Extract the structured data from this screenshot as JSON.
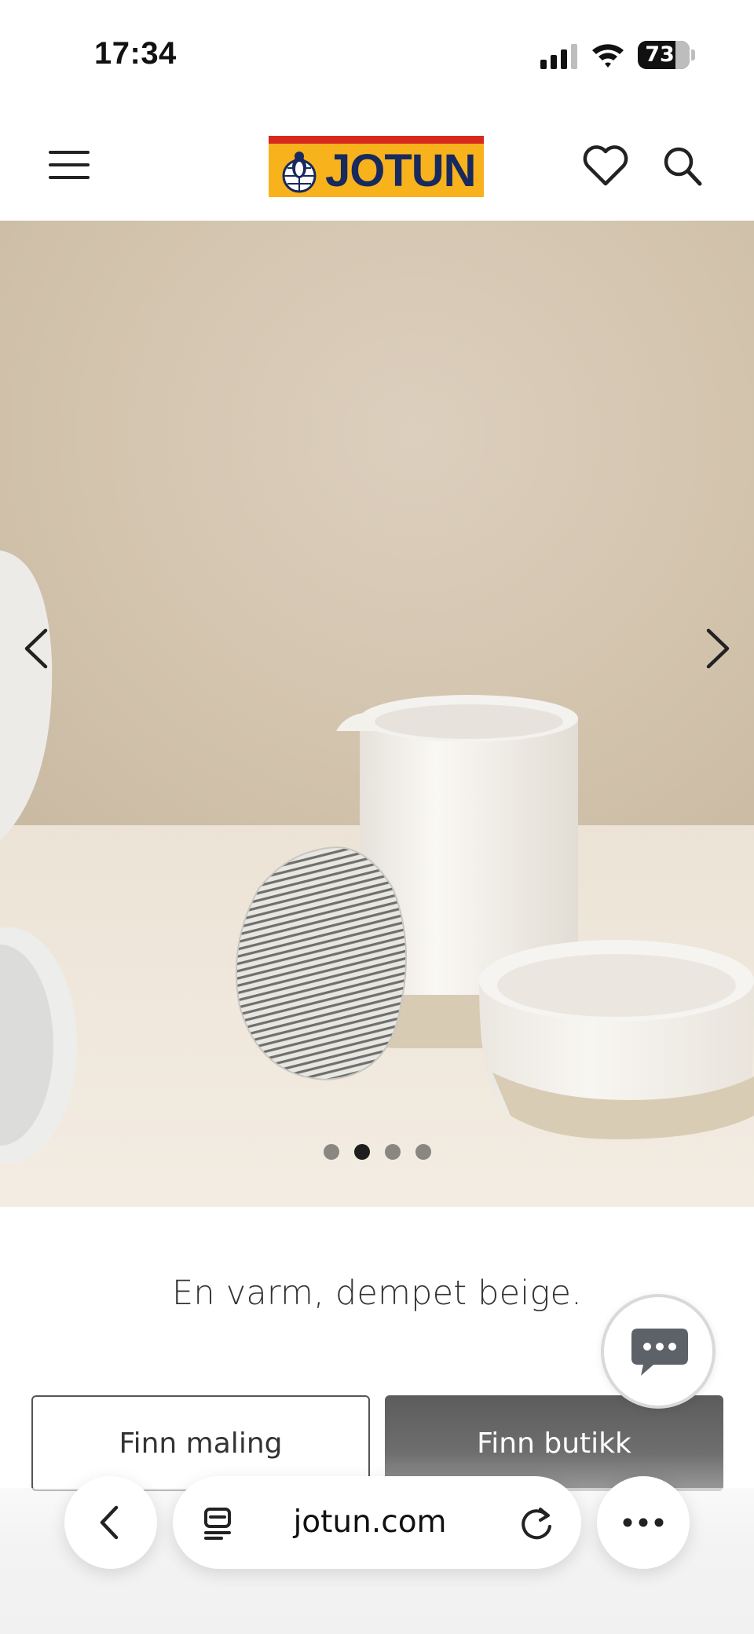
{
  "status_bar": {
    "time": "17:34",
    "battery": "73",
    "icons": [
      "signal-icon",
      "wifi-icon",
      "battery-icon"
    ]
  },
  "header": {
    "brand": "JOTUN",
    "icons": [
      "menu-icon",
      "heart-icon",
      "search-icon"
    ],
    "colors": {
      "logo_yellow": "#f7b21c",
      "logo_red": "#d72a1c",
      "logo_navy": "#17295e"
    }
  },
  "carousel": {
    "slide_count": 4,
    "active_slide": 2,
    "prev_icon": "chevron-left-icon",
    "next_icon": "chevron-right-icon"
  },
  "content": {
    "tagline": "En varm, dempet beige.",
    "primary_button": "Finn maling",
    "secondary_button": "Finn butikk",
    "chat_icon": "chat-bubble-icon"
  },
  "browser_bar": {
    "url": "jotun.com",
    "icons": [
      "back-icon",
      "tabs-icon",
      "reload-icon",
      "more-icon"
    ]
  }
}
